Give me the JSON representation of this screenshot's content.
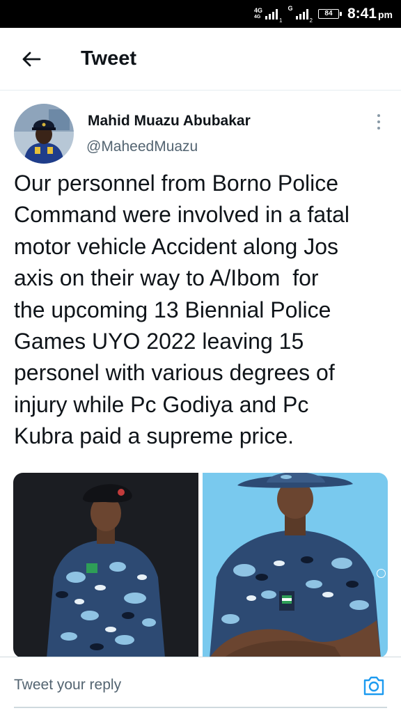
{
  "status_bar": {
    "network_label_1": "4G",
    "network_label_2": "4G",
    "sim1_number": "1",
    "sim2_label": "G",
    "sim2_number": "2",
    "battery": "84",
    "time": "8:41",
    "time_suffix": "pm"
  },
  "header": {
    "back_icon": "arrow-left-icon",
    "title": "Tweet"
  },
  "tweet": {
    "author_name": "Mahid Muazu Abubakar",
    "author_handle": "@MaheedMuazu",
    "more_icon": "more-vertical-icon",
    "text": "Our personnel from Borno Police\nCommand were involved in a fatal\nmotor vehicle Accident along Jos\naxis on their way to A/Ibom  for\nthe upcoming 13 Biennial Police\nGames UYO 2022 leaving 15\npersonel with various degrees of\ninjury while Pc Godiya and Pc\nKubra paid a supreme price.",
    "media_count": 2
  },
  "reply": {
    "placeholder": "Tweet your reply",
    "camera_icon": "camera-icon"
  },
  "colors": {
    "accent": "#1d9bf0",
    "text_primary": "#0f1419",
    "text_secondary": "#536471",
    "divider": "#e6ecf0"
  }
}
